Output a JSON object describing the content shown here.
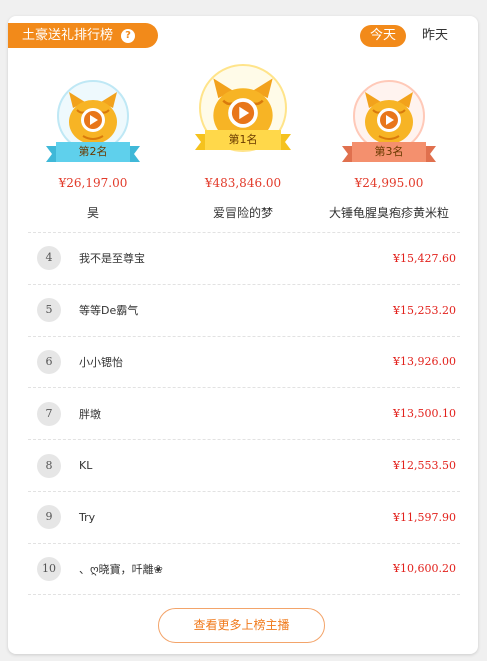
{
  "header": {
    "title": "土豪送礼排行榜",
    "help_glyph": "?",
    "tabs": [
      {
        "label": "今天",
        "active": true
      },
      {
        "label": "昨天",
        "active": false
      }
    ]
  },
  "podium": [
    {
      "rank_label": "第2名",
      "amount": "¥26,197.00",
      "name": "昊",
      "ring_color": "#bfe8f5",
      "ribbon_color": "#5fd0ec"
    },
    {
      "rank_label": "第1名",
      "amount": "¥483,846.00",
      "name": "爱冒险的梦",
      "ring_color": "#ffe48a",
      "ribbon_color": "#ffd84a"
    },
    {
      "rank_label": "第3名",
      "amount": "¥24,995.00",
      "name": "大锤龟腥臭疱疹黄米粒",
      "ring_color": "#ffc9b8",
      "ribbon_color": "#f4906e"
    }
  ],
  "list": [
    {
      "rank": "4",
      "name": "我不是至尊宝",
      "amount": "¥15,427.60"
    },
    {
      "rank": "5",
      "name": "等等De霸气",
      "amount": "¥15,253.20"
    },
    {
      "rank": "6",
      "name": "小小锶怡",
      "amount": "¥13,926.00"
    },
    {
      "rank": "7",
      "name": "胖墩",
      "amount": "¥13,500.10"
    },
    {
      "rank": "8",
      "name": "KL",
      "amount": "¥12,553.50"
    },
    {
      "rank": "9",
      "name": "Try",
      "amount": "¥11,597.90"
    },
    {
      "rank": "10",
      "name": "、ღ晓寶，吀離❀",
      "amount": "¥10,600.20"
    }
  ],
  "footer": {
    "more_label": "查看更多上榜主播"
  },
  "colors": {
    "accent": "#f28a1a",
    "amount_red": "#e2211c"
  }
}
